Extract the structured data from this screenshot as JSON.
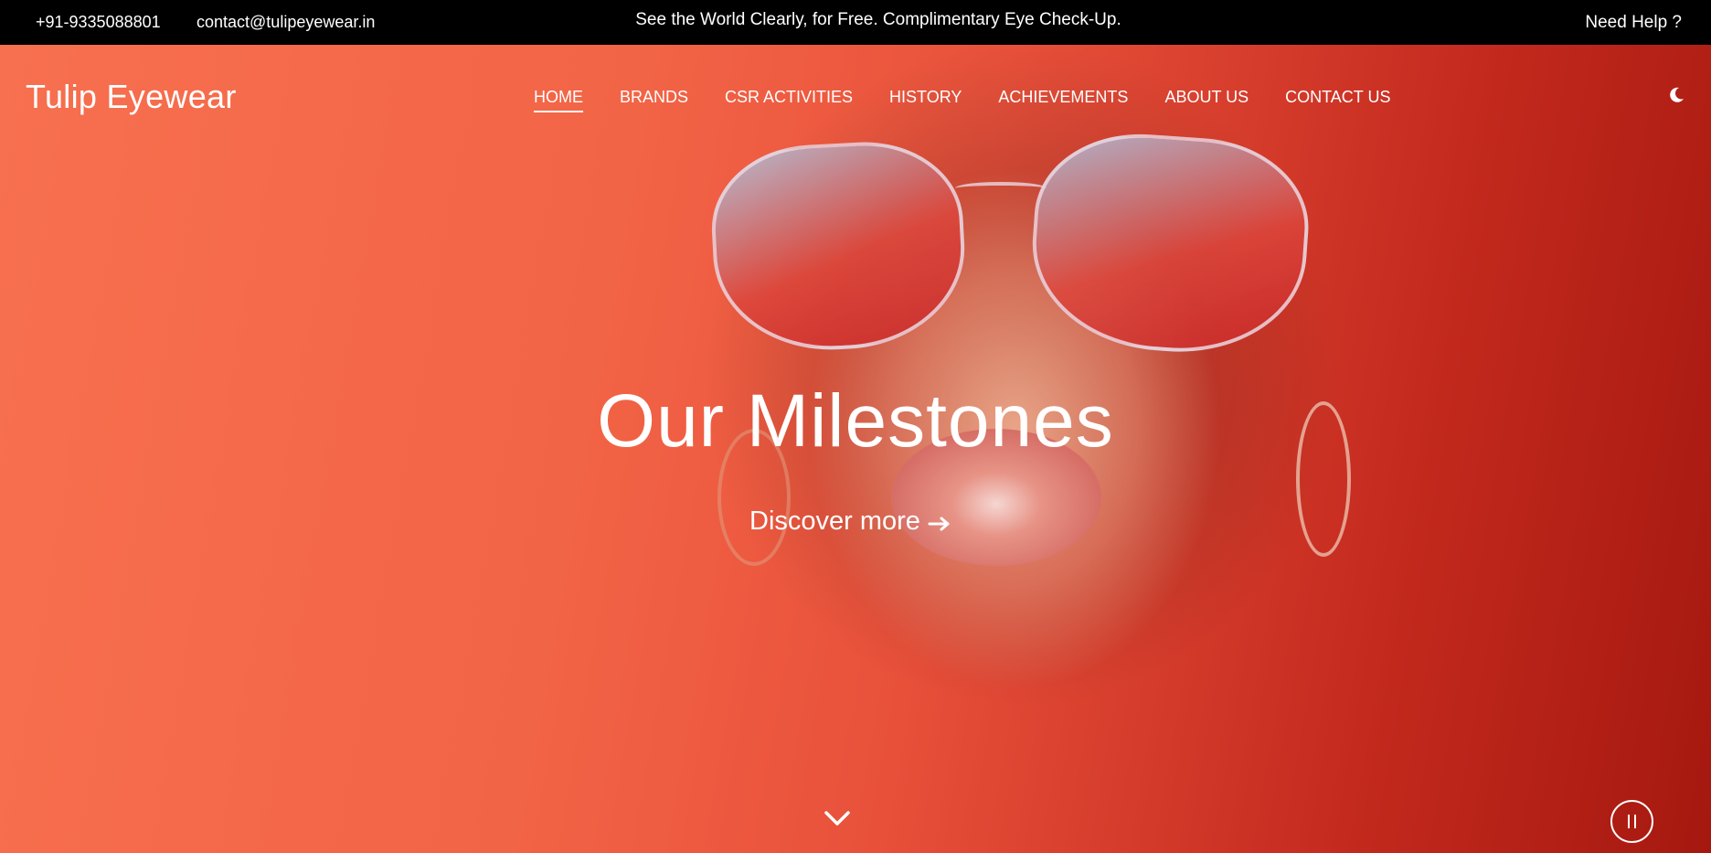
{
  "topbar": {
    "phone": "+91-9335088801",
    "email": "contact@tulipeyewear.in",
    "promo": "See the World Clearly, for Free. Complimentary Eye Check-Up.",
    "help": "Need Help ?"
  },
  "nav": {
    "brand": "Tulip Eyewear",
    "items": [
      {
        "label": "HOME",
        "active": true
      },
      {
        "label": "BRANDS"
      },
      {
        "label": "CSR ACTIVITIES"
      },
      {
        "label": "HISTORY"
      },
      {
        "label": "ACHIEVEMENTS"
      },
      {
        "label": "ABOUT US"
      },
      {
        "label": "CONTACT US"
      }
    ],
    "theme_icon": "moon-icon"
  },
  "hero": {
    "headline": "Our Milestones",
    "cta": "Discover more",
    "cta_icon": "arrow-right-icon",
    "scroll_icon": "chevron-down-icon",
    "pause_icon": "pause-icon"
  },
  "colors": {
    "topbar_bg": "#000000",
    "hero_left": "#f7704f",
    "hero_right": "#a5180f",
    "text": "#ffffff"
  }
}
